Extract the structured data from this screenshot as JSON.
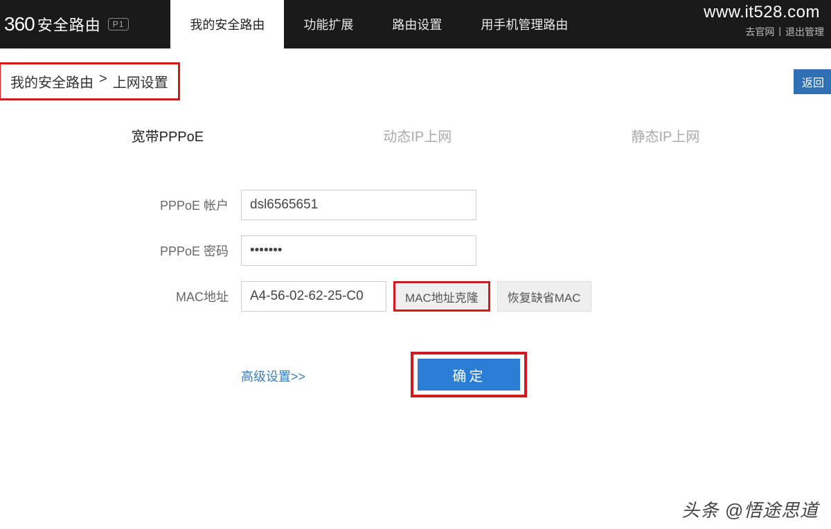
{
  "brand": {
    "logo_prefix": "360",
    "name": "安全路由",
    "model": "P1"
  },
  "nav": {
    "tabs": [
      "我的安全路由",
      "功能扩展",
      "路由设置",
      "用手机管理路由"
    ],
    "top_link_1": "去官网",
    "top_link_sep": "|",
    "top_link_2": "退出管理"
  },
  "watermark": "www.it528.com",
  "breadcrumb": {
    "part1": "我的安全路由",
    "sep": ">",
    "part2": "上网设置"
  },
  "back": "返回",
  "subtabs": {
    "pppoe": "宽带PPPoE",
    "dynamic": "动态IP上网",
    "static": "静态IP上网"
  },
  "form": {
    "account_label": "PPPoE 帐户",
    "account_value": "dsl6565651",
    "password_label": "PPPoE 密码",
    "password_value": "•••••••",
    "mac_label": "MAC地址",
    "mac_value": "A4-56-02-62-25-C0",
    "clone_btn": "MAC地址克隆",
    "restore_btn": "恢复缺省MAC",
    "advanced": "高级设置>>",
    "confirm": "确定"
  },
  "footer": "头条 @悟途思道"
}
